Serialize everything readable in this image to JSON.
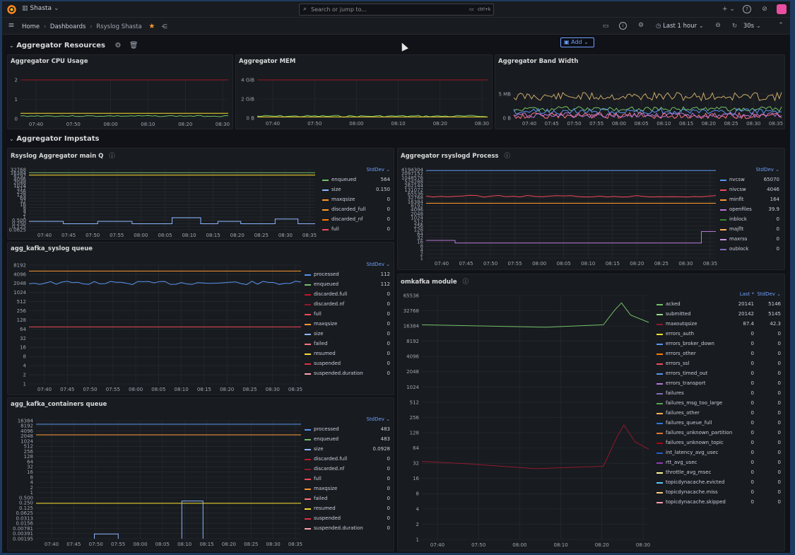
{
  "topbar": {
    "org": "Shasta",
    "search_placeholder": "Search or jump to...",
    "shortcut": "ctrl+k",
    "plus": "+",
    "colors": {
      "accent": "#6e9fff",
      "orange": "#ff7a00"
    }
  },
  "breadcrumb": {
    "home": "Home",
    "dashboards": "Dashboards",
    "current": "Rsyslog Shasta",
    "sep": "›"
  },
  "toolbar": {
    "add": "Add",
    "time_range": "Last 1 hour",
    "refresh": "30s"
  },
  "rows": {
    "resources": "Aggregator Resources",
    "impstats": "Aggregator Impstats"
  },
  "panels": {
    "cpu": {
      "title": "Aggregator CPU Usage",
      "y_ticks": [
        "2",
        "1",
        "0"
      ],
      "x_ticks": [
        "07:40",
        "07:50",
        "08:00",
        "08:10",
        "08:20",
        "08:30"
      ]
    },
    "mem": {
      "title": "Aggregator MEM",
      "y_ticks": [
        "4 GiB",
        "2 GiB",
        "0 B"
      ],
      "x_ticks": [
        "07:40",
        "07:50",
        "08:00",
        "08:10",
        "08:20",
        "08:30"
      ]
    },
    "bw": {
      "title": "Aggregator Band Width",
      "y_ticks": [
        "5 MB",
        "0 B"
      ],
      "x_ticks": [
        "07:40",
        "07:45",
        "07:50",
        "07:55",
        "08:00",
        "08:05",
        "08:10",
        "08:15",
        "08:20",
        "08:25",
        "08:30",
        "08:35"
      ]
    },
    "mainq": {
      "title": "Rsyslog Aggregator main Q",
      "y_ticks": [
        "32768",
        "16384",
        "8192",
        "4096",
        "2048",
        "1024",
        "512",
        "256",
        "128",
        "64",
        "32",
        "16",
        "8",
        "4",
        "2",
        "1",
        "0.500",
        "0.250",
        "0.125",
        "0.0625"
      ],
      "x_ticks": [
        "07:40",
        "07:45",
        "07:50",
        "07:55",
        "08:00",
        "08:05",
        "08:10",
        "08:15",
        "08:20",
        "08:25",
        "08:30",
        "08:35"
      ],
      "legend_header": "StdDev",
      "legend": [
        {
          "name": "enqueued",
          "value": "564",
          "color": "#73bf69"
        },
        {
          "name": "size",
          "value": "0.150",
          "color": "#8ab8ff"
        },
        {
          "name": "maxqsize",
          "value": "0",
          "color": "#ff9830"
        },
        {
          "name": "discarded_full",
          "value": "0",
          "color": "#ff9830"
        },
        {
          "name": "discarded_nf",
          "value": "0",
          "color": "#ff7a00"
        },
        {
          "name": "full",
          "value": "0",
          "color": "#f2495c"
        }
      ]
    },
    "rsyslogd": {
      "title": "Aggregator rsyslogd Process",
      "y_ticks": [
        "4194304",
        "2097152",
        "1048576",
        "524288",
        "262144",
        "131072",
        "65536",
        "32768",
        "16384",
        "8192",
        "4096",
        "2048",
        "1024",
        "512",
        "256",
        "128",
        "64",
        "32",
        "16",
        "8",
        "4",
        "2",
        "1"
      ],
      "x_ticks": [
        "07:40",
        "07:45",
        "07:50",
        "07:55",
        "08:00",
        "08:05",
        "08:10",
        "08:15",
        "08:20",
        "08:25",
        "08:30",
        "08:35"
      ],
      "legend_header": "StdDev",
      "legend": [
        {
          "name": "nvcsw",
          "value": "65070",
          "color": "#5794f2"
        },
        {
          "name": "nivcsw",
          "value": "4046",
          "color": "#f2495c"
        },
        {
          "name": "minflt",
          "value": "164",
          "color": "#ff9830"
        },
        {
          "name": "openfiles",
          "value": "39.9",
          "color": "#b877d9"
        },
        {
          "name": "inblock",
          "value": "0",
          "color": "#37872d"
        },
        {
          "name": "majflt",
          "value": "0",
          "color": "#ffb357"
        },
        {
          "name": "maxrss",
          "value": "0",
          "color": "#ca95e5"
        },
        {
          "name": "oublock",
          "value": "0",
          "color": "#806eb7"
        }
      ]
    },
    "syslogq": {
      "title": "agg_kafka_syslog queue",
      "y_ticks": [
        "8192",
        "4096",
        "2048",
        "1024",
        "512",
        "256",
        "128",
        "64",
        "32",
        "16",
        "8",
        "4",
        "2",
        "1"
      ],
      "x_ticks": [
        "07:40",
        "07:45",
        "07:50",
        "07:55",
        "08:00",
        "08:05",
        "08:10",
        "08:15",
        "08:20",
        "08:25",
        "08:30",
        "08:35"
      ],
      "legend_header": "StdDev",
      "legend": [
        {
          "name": "processed",
          "value": "112",
          "color": "#5794f2"
        },
        {
          "name": "enqueued",
          "value": "112",
          "color": "#73bf69"
        },
        {
          "name": "discarded.full",
          "value": "0",
          "color": "#c4162a"
        },
        {
          "name": "discarded.nf",
          "value": "0",
          "color": "#8f1a2e"
        },
        {
          "name": "full",
          "value": "0",
          "color": "#f2495c"
        },
        {
          "name": "maxqsize",
          "value": "0",
          "color": "#ff9830"
        },
        {
          "name": "size",
          "value": "0",
          "color": "#8ab8ff"
        },
        {
          "name": "failed",
          "value": "0",
          "color": "#ff7383"
        },
        {
          "name": "resumed",
          "value": "0",
          "color": "#fade2a"
        },
        {
          "name": "suspended",
          "value": "0",
          "color": "#e02f44"
        },
        {
          "name": "suspended.duration",
          "value": "0",
          "color": "#ffa6b0"
        }
      ]
    },
    "omkafka": {
      "title": "omkafka module",
      "y_ticks": [
        "65536",
        "32768",
        "16384",
        "8192",
        "4096",
        "2048",
        "1024",
        "512",
        "256",
        "128",
        "64",
        "32",
        "16",
        "8",
        "4",
        "2",
        "1"
      ],
      "x_ticks": [
        "07:40",
        "07:50",
        "08:00",
        "08:10",
        "08:20",
        "08:30"
      ],
      "legend_header_last": "Last *",
      "legend_header": "StdDev",
      "legend": [
        {
          "name": "acked",
          "last": "20141",
          "value": "5146",
          "color": "#73bf69"
        },
        {
          "name": "submitted",
          "last": "20142",
          "value": "5145",
          "color": "#96d98d"
        },
        {
          "name": "maxoutqsize",
          "last": "87.4",
          "value": "42.3",
          "color": "#8f1a2e"
        },
        {
          "name": "errors_auth",
          "last": "0",
          "value": "0",
          "color": "#fade2a"
        },
        {
          "name": "errors_broker_down",
          "last": "0",
          "value": "0",
          "color": "#5794f2"
        },
        {
          "name": "errors_other",
          "last": "0",
          "value": "0",
          "color": "#ff7a00"
        },
        {
          "name": "errors_ssl",
          "last": "0",
          "value": "0",
          "color": "#f2495c"
        },
        {
          "name": "errors_timed_out",
          "last": "0",
          "value": "0",
          "color": "#5794f2"
        },
        {
          "name": "errors_transport",
          "last": "0",
          "value": "0",
          "color": "#b877d9"
        },
        {
          "name": "failures",
          "last": "0",
          "value": "0",
          "color": "#806eb7"
        },
        {
          "name": "failures_msg_too_large",
          "last": "0",
          "value": "0",
          "color": "#56a64b"
        },
        {
          "name": "failures_other",
          "last": "0",
          "value": "0",
          "color": "#ffb357"
        },
        {
          "name": "failures_queue_full",
          "last": "0",
          "value": "0",
          "color": "#3274d9"
        },
        {
          "name": "failures_unknown_partition",
          "last": "0",
          "value": "0",
          "color": "#e0752d"
        },
        {
          "name": "failures_unknown_topic",
          "last": "0",
          "value": "0",
          "color": "#ad0317"
        },
        {
          "name": "int_latency_avg_usec",
          "last": "0",
          "value": "0",
          "color": "#1f60c4"
        },
        {
          "name": "rtt_avg_usec",
          "last": "0",
          "value": "0",
          "color": "#8f3bb8"
        },
        {
          "name": "throttle_avg_msec",
          "last": "0",
          "value": "0",
          "color": "#fff899"
        },
        {
          "name": "topicdynacache.evicted",
          "last": "0",
          "value": "0",
          "color": "#5ac8fa"
        },
        {
          "name": "topicdynacache.miss",
          "last": "0",
          "value": "0",
          "color": "#ffcb7d"
        },
        {
          "name": "topicdynacache.skipped",
          "last": "0",
          "value": "0",
          "color": "#ff9eae"
        }
      ]
    },
    "containersq": {
      "title": "agg_kafka_containers queue",
      "y_ticks": [
        "16384",
        "8192",
        "4096",
        "2048",
        "1024",
        "512",
        "256",
        "128",
        "64",
        "32",
        "16",
        "8",
        "4",
        "2",
        "1",
        "0.500",
        "0.250",
        "0.125",
        "0.0625",
        "0.0313",
        "0.0156",
        "0.00781",
        "0.00391",
        "0.00195"
      ],
      "x_ticks": [
        "07:40",
        "07:45",
        "07:50",
        "07:55",
        "08:00",
        "08:05",
        "08:10",
        "08:15",
        "08:20",
        "08:25",
        "08:30",
        "08:35"
      ],
      "legend_header": "StdDev",
      "legend": [
        {
          "name": "processed",
          "value": "483",
          "color": "#5794f2"
        },
        {
          "name": "enqueued",
          "value": "483",
          "color": "#73bf69"
        },
        {
          "name": "size",
          "value": "0.0928",
          "color": "#8ab8ff"
        },
        {
          "name": "discarded.full",
          "value": "0",
          "color": "#c4162a"
        },
        {
          "name": "discarded.nf",
          "value": "0",
          "color": "#8f1a2e"
        },
        {
          "name": "full",
          "value": "0",
          "color": "#f2495c"
        },
        {
          "name": "maxqsize",
          "value": "0",
          "color": "#ff9830"
        },
        {
          "name": "failed",
          "value": "0",
          "color": "#ff7383"
        },
        {
          "name": "resumed",
          "value": "0",
          "color": "#fade2a"
        },
        {
          "name": "suspended",
          "value": "0",
          "color": "#e02f44"
        },
        {
          "name": "suspended.duration",
          "value": "0",
          "color": "#ffa6b0"
        }
      ]
    }
  }
}
